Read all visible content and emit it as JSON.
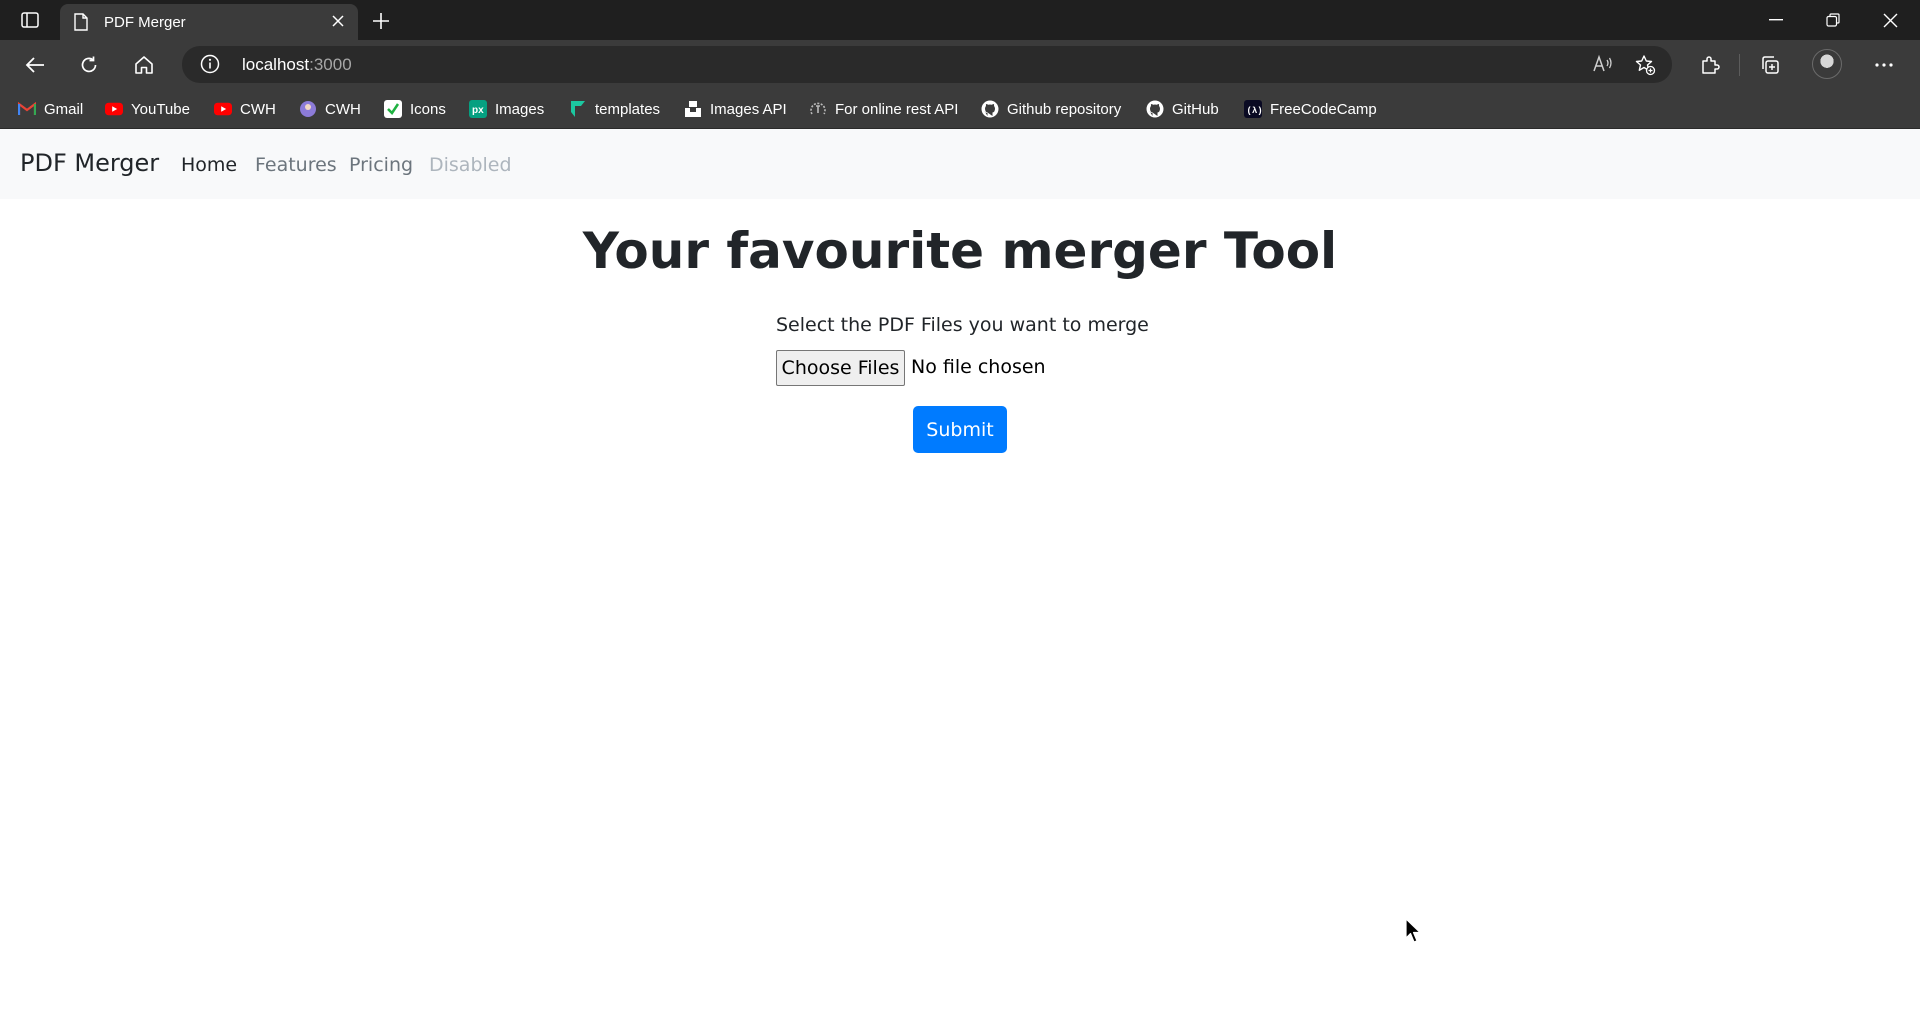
{
  "browser": {
    "tab": {
      "title": "PDF Merger"
    },
    "address": {
      "host": "localhost",
      "port": ":3000"
    },
    "bookmarks": [
      {
        "label": "Gmail",
        "icon": "gmail-icon"
      },
      {
        "label": "YouTube",
        "icon": "youtube-icon"
      },
      {
        "label": "CWH",
        "icon": "youtube-icon"
      },
      {
        "label": "CWH",
        "icon": "cwh-icon"
      },
      {
        "label": "Icons",
        "icon": "icons8-icon"
      },
      {
        "label": "Images",
        "icon": "pexels-icon"
      },
      {
        "label": "templates",
        "icon": "templates-icon"
      },
      {
        "label": "Images API",
        "icon": "unsplash-icon"
      },
      {
        "label": "For online rest API",
        "icon": "rest-api-icon"
      },
      {
        "label": "Github repository",
        "icon": "github-icon"
      },
      {
        "label": "GitHub",
        "icon": "github-icon"
      },
      {
        "label": "FreeCodeCamp",
        "icon": "freecodecamp-icon"
      }
    ]
  },
  "nav": {
    "brand": "PDF Merger",
    "links": [
      "Home",
      "Features",
      "Pricing",
      "Disabled"
    ]
  },
  "main": {
    "title": "Your favourite merger Tool",
    "label": "Select the PDF Files you want to merge",
    "file_button": "Choose Files",
    "file_status": "No file chosen",
    "submit": "Submit"
  },
  "colors": {
    "primary": "#007bff",
    "chrome_dark": "#1f1f1f",
    "chrome_tab": "#3b3b3b",
    "navbar_bg": "#f8f9fa"
  }
}
